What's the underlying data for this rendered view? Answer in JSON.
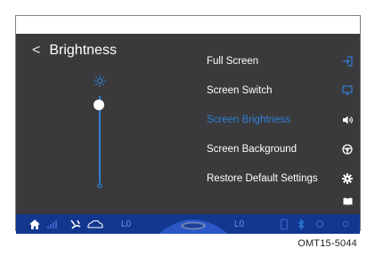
{
  "header": {
    "back_symbol": "<",
    "title": "Brightness"
  },
  "slider": {
    "level": 0.9
  },
  "menu": [
    {
      "label": "Full Screen",
      "icon": "enter-icon",
      "active": false
    },
    {
      "label": "Screen Switch",
      "icon": "monitor-icon",
      "active": false
    },
    {
      "label": "Screen Brightness",
      "icon": "speaker-icon",
      "active": true
    },
    {
      "label": "Screen Background",
      "icon": "steering-wheel-icon",
      "active": false
    },
    {
      "label": "Restore Default Settings",
      "icon": "gear-icon",
      "active": false
    }
  ],
  "bottom_bar": {
    "left_level": "L0",
    "right_level": "L0"
  },
  "caption": "OMT15-5044",
  "colors": {
    "accent": "#2f7fd6",
    "screen_bg": "#3a3a3c",
    "bar_bg": "#13378f"
  }
}
